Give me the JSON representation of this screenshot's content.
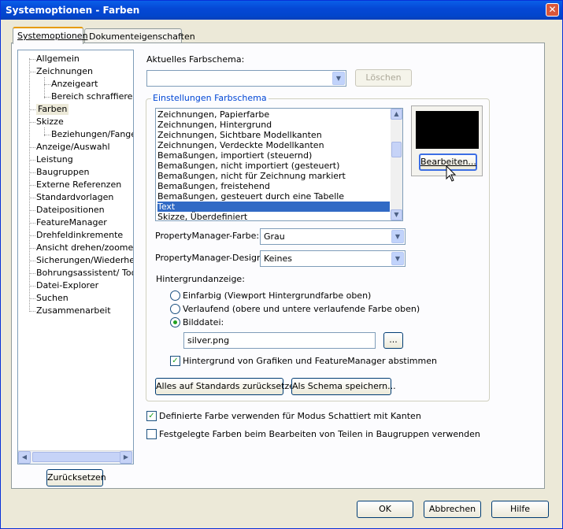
{
  "window": {
    "title": "Systemoptionen - Farben",
    "close_glyph": "✕"
  },
  "tabs": [
    {
      "label": "Systemoptionen"
    },
    {
      "label": "Dokumenteigenschaften"
    }
  ],
  "tree": [
    {
      "label": "Allgemein",
      "level": 0
    },
    {
      "label": "Zeichnungen",
      "level": 0
    },
    {
      "label": "Anzeigeart",
      "level": 1
    },
    {
      "label": "Bereich schraffieren/f",
      "level": 1
    },
    {
      "label": "Farben",
      "level": 0,
      "selected": true
    },
    {
      "label": "Skizze",
      "level": 0
    },
    {
      "label": "Beziehungen/Fangen",
      "level": 1
    },
    {
      "label": "Anzeige/Auswahl",
      "level": 0
    },
    {
      "label": "Leistung",
      "level": 0
    },
    {
      "label": "Baugruppen",
      "level": 0
    },
    {
      "label": "Externe Referenzen",
      "level": 0
    },
    {
      "label": "Standardvorlagen",
      "level": 0
    },
    {
      "label": "Dateipositionen",
      "level": 0
    },
    {
      "label": "FeatureManager",
      "level": 0
    },
    {
      "label": "Drehfeldinkremente",
      "level": 0
    },
    {
      "label": "Ansicht drehen/zoomen",
      "level": 0
    },
    {
      "label": "Sicherungen/Wiederherst",
      "level": 0
    },
    {
      "label": "Bohrungsassistent/ Toolb",
      "level": 0
    },
    {
      "label": "Datei-Explorer",
      "level": 0
    },
    {
      "label": "Suchen",
      "level": 0
    },
    {
      "label": "Zusammenarbeit",
      "level": 0
    }
  ],
  "reset_tree_button": "Zurücksetzen",
  "scheme": {
    "label": "Aktuelles Farbschema:",
    "value": "",
    "delete_button": "Löschen"
  },
  "group_title": "Einstellungen Farbschema",
  "color_items": [
    "Zeichnungen, Papierfarbe",
    "Zeichnungen, Hintergrund",
    "Zeichnungen, Sichtbare Modellkanten",
    "Zeichnungen, Verdeckte Modellkanten",
    "Bemaßungen, importiert (steuernd)",
    "Bemaßungen, nicht importiert (gesteuert)",
    "Bemaßungen, nicht für Zeichnung markiert",
    "Bemaßungen, freistehend",
    "Bemaßungen, gesteuert durch eine Tabelle",
    "Text",
    "Skizze, Überdefiniert"
  ],
  "selected_color_item": "Text",
  "preview_color": "#000000",
  "edit_button": "Bearbeiten...",
  "pm_color": {
    "label": "PropertyManager-Farbe:",
    "value": "Grau"
  },
  "pm_design": {
    "label": "PropertyManager-Design:",
    "value": "Keines"
  },
  "background": {
    "label": "Hintergrundanzeige:",
    "options": [
      "Einfarbig (Viewport Hintergrundfarbe oben)",
      "Verlaufend (obere und untere verlaufende Farbe oben)",
      "Bilddatei:"
    ],
    "selected_index": 2,
    "file": "silver.png",
    "browse": "...",
    "match_label": "Hintergrund von Grafiken und FeatureManager abstimmen",
    "match_checked": true
  },
  "reset_defaults_button": "Alles auf Standards zurücksetzen",
  "save_scheme_button": "Als Schema speichern...",
  "options": [
    {
      "label": "Definierte Farbe verwenden für Modus Schattiert mit Kanten",
      "checked": true
    },
    {
      "label": "Festgelegte Farben beim Bearbeiten von Teilen in Baugruppen verwenden",
      "checked": false
    }
  ],
  "footer": {
    "ok": "OK",
    "cancel": "Abbrechen",
    "help": "Hilfe"
  }
}
